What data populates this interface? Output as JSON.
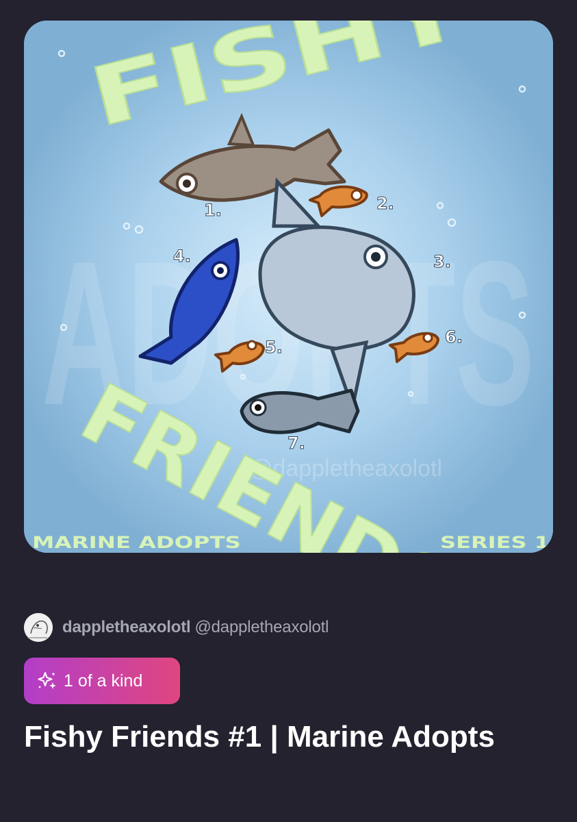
{
  "artwork": {
    "title_top": "FISHY",
    "title_bottom": "FRIENDS",
    "watermark_word": "ADOPTS",
    "watermark_handle": "@dappletheaxolotl",
    "corner_left": "MARINE ADOPTS",
    "corner_right": "SERIES 1",
    "fish_numbers": [
      "1.",
      "2.",
      "3.",
      "4.",
      "5.",
      "6.",
      "7."
    ],
    "colors": {
      "background": "#7fafd3",
      "glow": "#cfe8f8",
      "lettering": "#d8f3b8",
      "brown_fish": "#9c8f84",
      "goldfish": "#e08a3a",
      "blue_fish": "#2c4fc8",
      "sunfish": "#b8c8d8",
      "spotted_fish": "#8a9aaa"
    }
  },
  "creator": {
    "name": "dappletheaxolotl",
    "handle": "@dappletheaxolotl",
    "avatar_icon": "avatar-sketch-icon"
  },
  "badge": {
    "label": "1 of a kind",
    "icon": "sparkle-icon",
    "gradient": [
      "#b33ec9",
      "#e0467f"
    ]
  },
  "listing": {
    "title": "Fishy Friends #1 | Marine Adopts"
  },
  "page": {
    "background": "#23222e"
  }
}
